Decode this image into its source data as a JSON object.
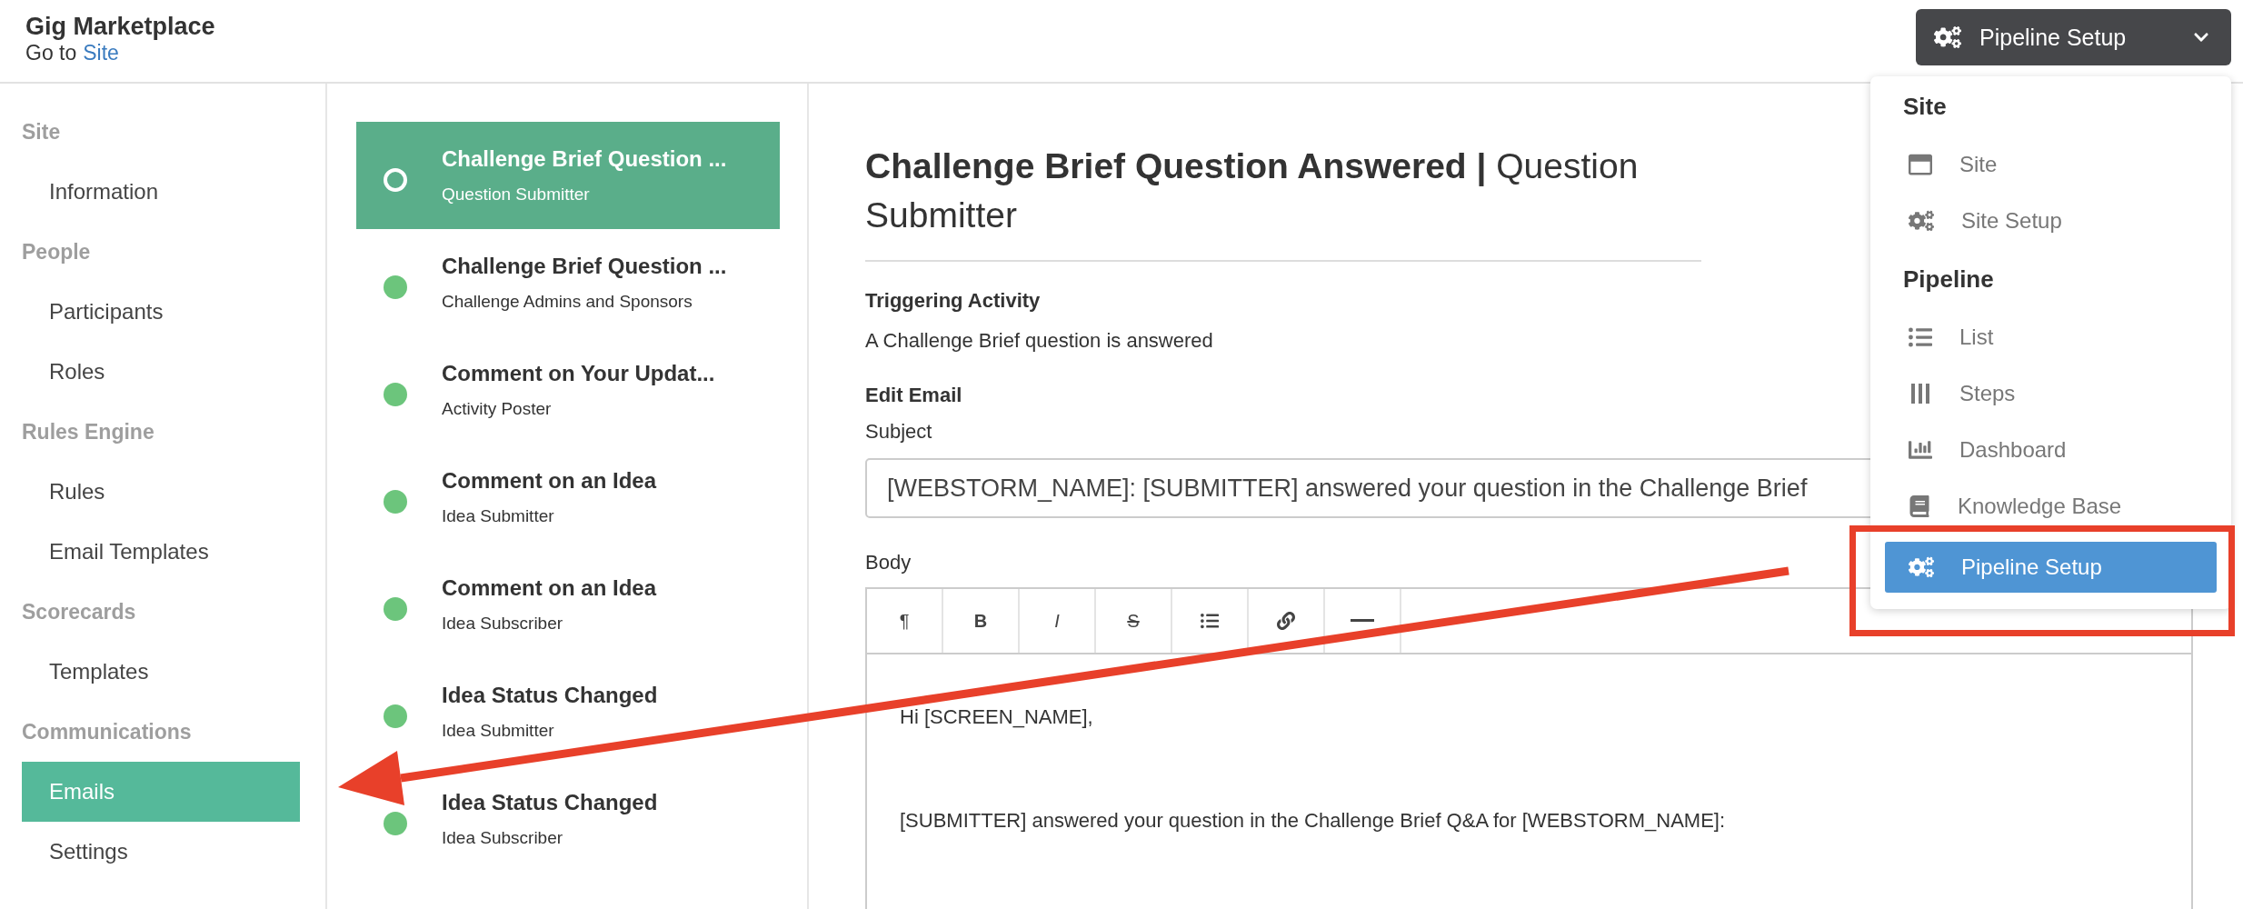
{
  "header": {
    "title": "Gig Marketplace",
    "goto_prefix": "Go to",
    "goto_link": "Site",
    "menu_button": "Pipeline Setup"
  },
  "sidebar": {
    "groups": [
      {
        "label": "Site",
        "items": [
          {
            "label": "Information",
            "selected": false
          }
        ]
      },
      {
        "label": "People",
        "items": [
          {
            "label": "Participants",
            "selected": false
          },
          {
            "label": "Roles",
            "selected": false
          }
        ]
      },
      {
        "label": "Rules Engine",
        "items": [
          {
            "label": "Rules",
            "selected": false
          },
          {
            "label": "Email Templates",
            "selected": false
          }
        ]
      },
      {
        "label": "Scorecards",
        "items": [
          {
            "label": "Templates",
            "selected": false
          }
        ]
      },
      {
        "label": "Communications",
        "items": [
          {
            "label": "Emails",
            "selected": true
          },
          {
            "label": "Settings",
            "selected": false
          }
        ]
      }
    ]
  },
  "emails": [
    {
      "title": "Challenge Brief Question ...",
      "recipient": "Question Submitter",
      "selected": true
    },
    {
      "title": "Challenge Brief Question ...",
      "recipient": "Challenge Admins and Sponsors",
      "selected": false
    },
    {
      "title": "Comment on Your Updat...",
      "recipient": "Activity Poster",
      "selected": false
    },
    {
      "title": "Comment on an Idea",
      "recipient": "Idea Submitter",
      "selected": false
    },
    {
      "title": "Comment on an Idea",
      "recipient": "Idea Subscriber",
      "selected": false
    },
    {
      "title": "Idea Status Changed",
      "recipient": "Idea Submitter",
      "selected": false
    },
    {
      "title": "Idea Status Changed",
      "recipient": "Idea Subscriber",
      "selected": false
    }
  ],
  "detail": {
    "title": "**Challenge Brief Question Answered |** Question Submitter",
    "trigger_label": "Triggering Activity",
    "trigger_text": "A Challenge Brief question is answered",
    "edit_label": "Edit Email",
    "subject_label": "Subject",
    "subject_value": "[WEBSTORM_NAME]: [SUBMITTER] answered your question in the Challenge Brief",
    "body_label": "Body",
    "toolbar": [
      {
        "kind": "paragraph",
        "label": "¶"
      },
      {
        "kind": "bold",
        "label": "B"
      },
      {
        "kind": "italic",
        "label": "I"
      },
      {
        "kind": "strike",
        "label": "S"
      },
      {
        "kind": "list"
      },
      {
        "kind": "link"
      },
      {
        "kind": "rule"
      }
    ],
    "body_lines": [
      "Hi [SCREEN_NAME],",
      "[SUBMITTER] answered your question in the Challenge Brief Q&A for [WEBSTORM_NAME]:"
    ]
  },
  "menu": {
    "sections": [
      {
        "heading": "Site",
        "items": [
          {
            "label": "Site",
            "kind": "window",
            "selected": false
          },
          {
            "label": "Site Setup",
            "kind": "gears",
            "selected": false
          }
        ]
      },
      {
        "heading": "Pipeline",
        "items": [
          {
            "label": "List",
            "kind": "list",
            "selected": false
          },
          {
            "label": "Steps",
            "kind": "steps",
            "selected": false
          },
          {
            "label": "Dashboard",
            "kind": "chart",
            "selected": false
          },
          {
            "label": "Knowledge Base",
            "kind": "book",
            "selected": false
          },
          {
            "label": "Pipeline Setup",
            "kind": "gears",
            "selected": true
          }
        ]
      }
    ]
  }
}
